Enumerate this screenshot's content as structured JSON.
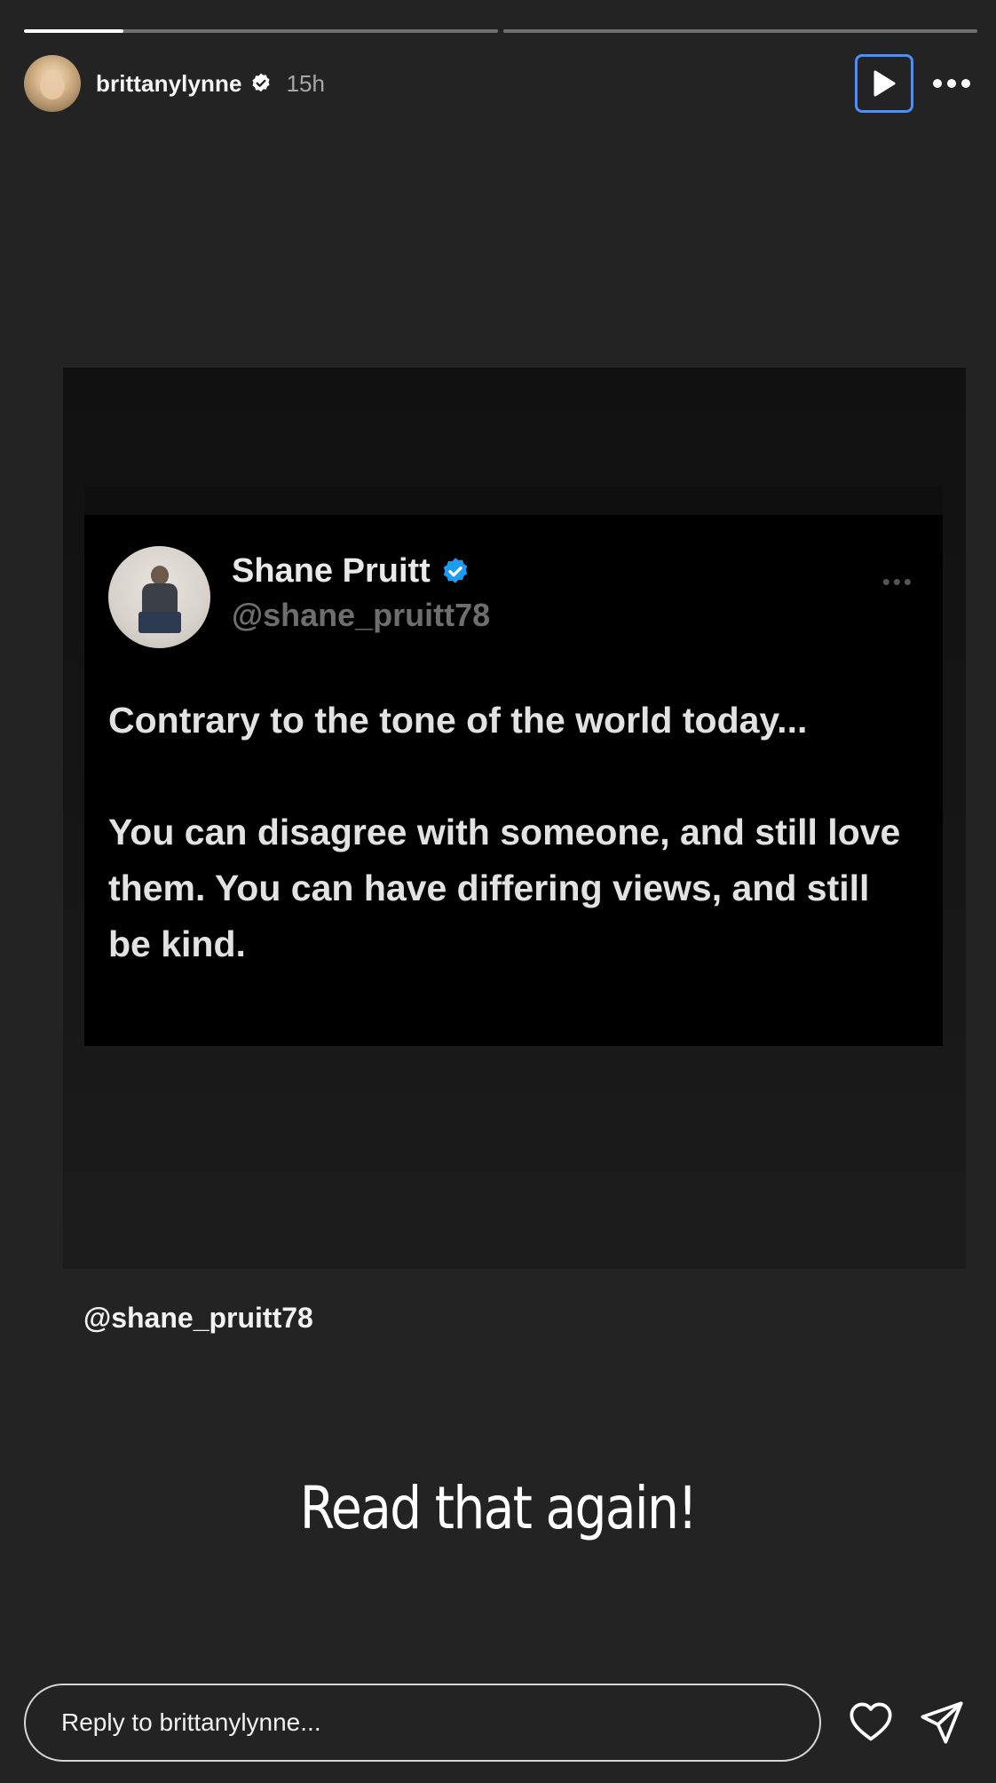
{
  "story": {
    "progress": [
      0.21,
      0.0
    ],
    "author": {
      "username": "brittanylynne",
      "verified": true,
      "time_ago": "15h"
    },
    "controls": {
      "play_icon": "play-icon",
      "more_icon": "more-horizontal-icon"
    },
    "post": {
      "author_name": "Shane Pruitt",
      "author_handle": "@shane_pruitt78",
      "verified_color": "#1d9bf0",
      "more": "•••",
      "paragraph_1": "Contrary to the tone of the world today...",
      "paragraph_2": "You can disagree with someone, and still love them. You can have differing views, and still be kind."
    },
    "mention": "@shane_pruitt78",
    "caption": "Read that again!"
  },
  "footer": {
    "reply_placeholder": "Reply to brittanylynne...",
    "like_icon": "heart-icon",
    "share_icon": "send-icon"
  },
  "colors": {
    "background": "#232323",
    "focus_ring": "#4a8fff"
  }
}
